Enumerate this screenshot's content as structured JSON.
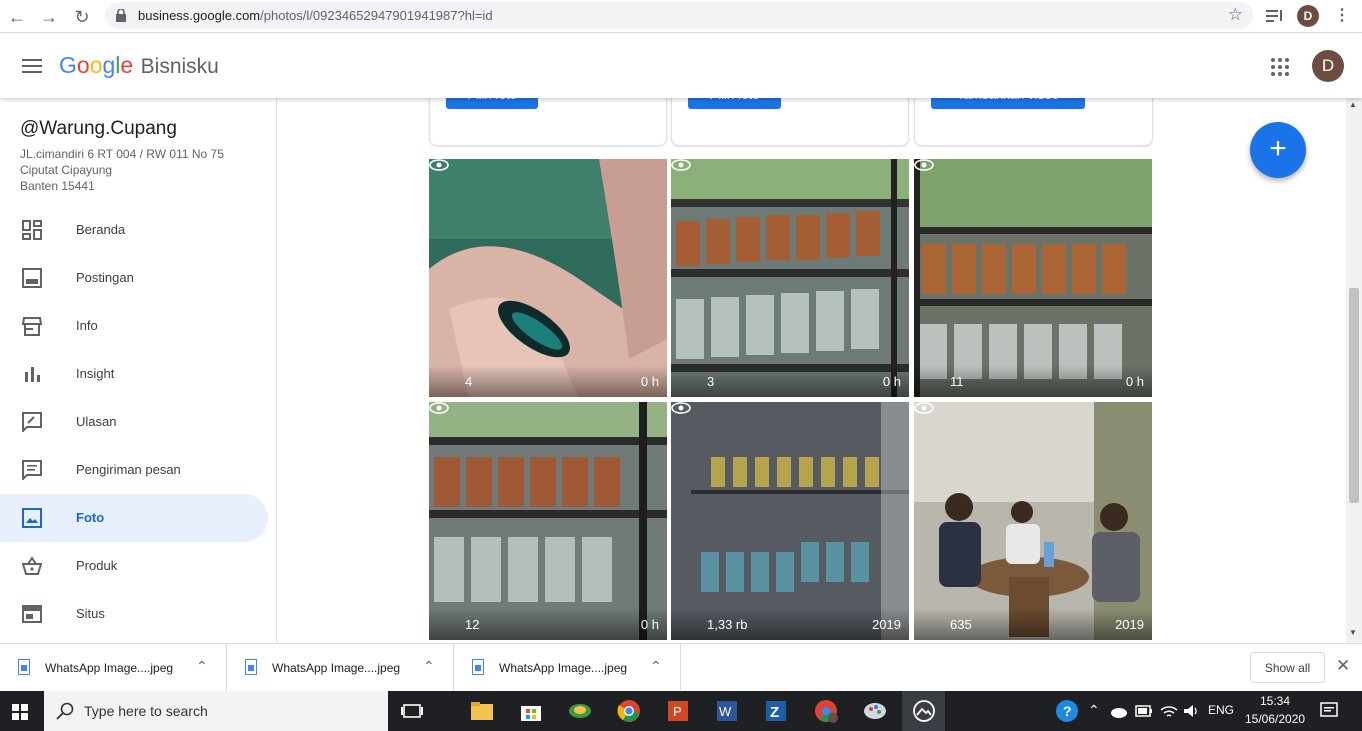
{
  "browser": {
    "url_host": "business.google.com",
    "url_path": "/photos/l/09234652947901941987?hl=id",
    "profile_initial": "D"
  },
  "appbar": {
    "logo_letters": [
      "G",
      "o",
      "o",
      "g",
      "l",
      "e"
    ],
    "logo_colors": [
      "#4285f4",
      "#ea4335",
      "#fbbc05",
      "#4285f4",
      "#34a853",
      "#ea4335"
    ],
    "product": "Bisnisku",
    "avatar_initial": "D"
  },
  "business": {
    "name": "@Warung.Cupang",
    "address_line1": "JL.cimandiri 6 RT 004 / RW 011 No 75",
    "address_line2": "Ciputat Cipayung",
    "address_line3": "Banten 15441"
  },
  "nav": [
    {
      "label": "Beranda",
      "icon": "dashboard-icon"
    },
    {
      "label": "Postingan",
      "icon": "posts-icon"
    },
    {
      "label": "Info",
      "icon": "storefront-icon"
    },
    {
      "label": "Insight",
      "icon": "bar-chart-icon"
    },
    {
      "label": "Ulasan",
      "icon": "review-icon"
    },
    {
      "label": "Pengiriman pesan",
      "icon": "message-icon"
    },
    {
      "label": "Foto",
      "icon": "photo-icon",
      "active": true
    },
    {
      "label": "Produk",
      "icon": "basket-icon"
    },
    {
      "label": "Situs",
      "icon": "website-icon"
    }
  ],
  "upload_cards": [
    {
      "button": "Pilih foto"
    },
    {
      "button": "Pilih foto"
    },
    {
      "button": "Tambahkan video"
    }
  ],
  "photos": [
    {
      "views": "4",
      "age": "0 h",
      "scene": "hand-with-fish"
    },
    {
      "views": "3",
      "age": "0 h",
      "scene": "shelf-jars"
    },
    {
      "views": "11",
      "age": "0 h",
      "scene": "shelf-jars"
    },
    {
      "views": "12",
      "age": "0 h",
      "scene": "shelf-jars"
    },
    {
      "views": "1,33 rb",
      "age": "2019",
      "scene": "wall-jars"
    },
    {
      "views": "635",
      "age": "2019",
      "scene": "people-table"
    }
  ],
  "downloads": [
    {
      "name": "WhatsApp Image....jpeg"
    },
    {
      "name": "WhatsApp Image....jpeg"
    },
    {
      "name": "WhatsApp Image....jpeg"
    }
  ],
  "show_all": "Show all",
  "taskbar": {
    "search_placeholder": "Type here to search",
    "lang": "ENG",
    "time": "15:34",
    "date": "15/06/2020"
  }
}
